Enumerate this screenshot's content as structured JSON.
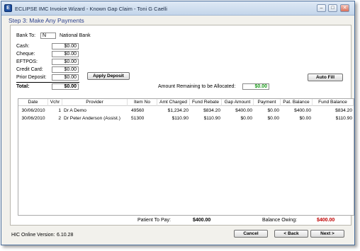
{
  "window": {
    "title": "ECLIPSE IMC Invoice Wizard - Known Gap Claim - Toni G Caelli",
    "app_icon_glyph": "E"
  },
  "controls": {
    "minimize": "–",
    "maximize": "□",
    "close": "✕"
  },
  "step": {
    "title": "Step 3: Make Any Payments"
  },
  "bank": {
    "label": "Bank To:",
    "value": "N",
    "name": "National Bank"
  },
  "payments": [
    {
      "label": "Cash:",
      "value": "$0.00"
    },
    {
      "label": "Cheque:",
      "value": "$0.00"
    },
    {
      "label": "EFTPOS:",
      "value": "$0.00"
    },
    {
      "label": "Credit Card:",
      "value": "$0.00"
    },
    {
      "label": "Prior Deposit:",
      "value": "$0.00"
    }
  ],
  "total": {
    "label": "Total:",
    "value": "$0.00"
  },
  "buttons": {
    "apply_deposit": "Apply Deposit",
    "auto_fill": "Auto Fill",
    "cancel": "Cancel",
    "back": "< Back",
    "next": "Next >"
  },
  "allocation": {
    "label": "Amount Remaining to be Allocated:",
    "value": "$0.00",
    "value_color": "#1a9a1a"
  },
  "table": {
    "columns": [
      "Date",
      "Vchr",
      "Provider",
      "Item No",
      "Amt Charged",
      "Fund Rebate",
      "Gap Amount",
      "Payment",
      "Pat. Balance",
      "Fund Balance"
    ],
    "rows": [
      [
        "30/06/2010",
        "1",
        "Dr A Demo",
        "49560",
        "$1,234.20",
        "$834.20",
        "$400.00",
        "$0.00",
        "$400.00",
        "$834.20"
      ],
      [
        "30/06/2010",
        "2",
        "Dr Peter Anderson (Assist.)",
        "51300",
        "$110.90",
        "$110.90",
        "$0.00",
        "$0.00",
        "$0.00",
        "$110.90"
      ]
    ]
  },
  "summary": {
    "patient_label": "Patient To Pay:",
    "patient_value": "$400.00",
    "owing_label": "Balance Owing:",
    "owing_value": "$400.00",
    "owing_color": "#c00000"
  },
  "version": {
    "label": "HIC Online Version:",
    "value": "6.10.28"
  }
}
